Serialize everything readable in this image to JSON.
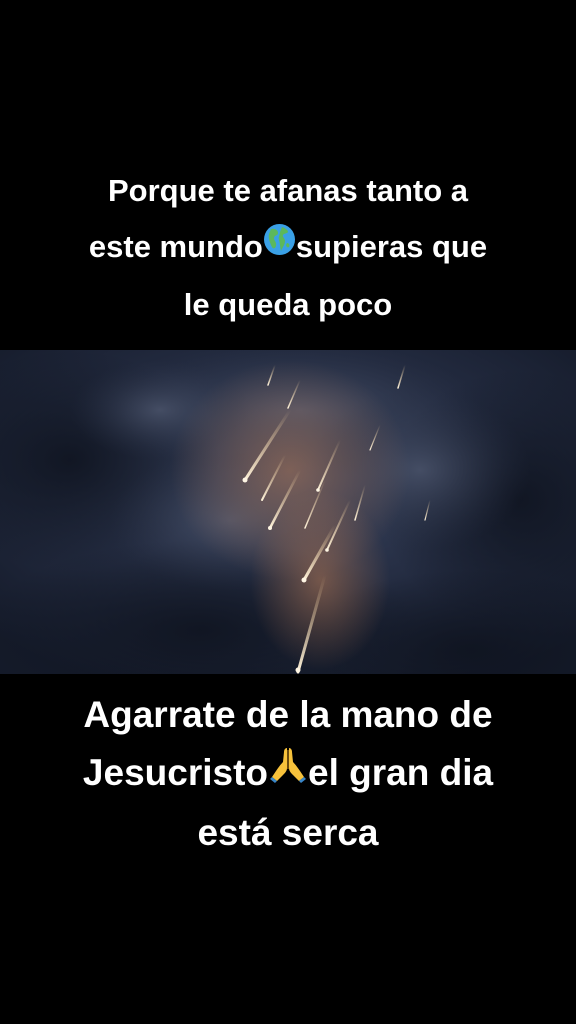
{
  "top_caption": {
    "line1": "Porque te afanas tanto a",
    "line2_before": "este mundo",
    "line2_emoji": "globe-americas-icon",
    "line2_after": "supieras que",
    "line3": "le queda poco"
  },
  "video": {
    "scene": "meteor-shower-icon"
  },
  "bottom_caption": {
    "line1": "Agarrate de la mano de",
    "line2_before": "Jesucristo",
    "line2_emoji": "praying-hands-icon",
    "line2_after": "el gran dia",
    "line3": "está serca"
  },
  "colors": {
    "background": "#000000",
    "text": "#ffffff",
    "sky": "#1d2436",
    "meteor": "#ffd9a0"
  }
}
